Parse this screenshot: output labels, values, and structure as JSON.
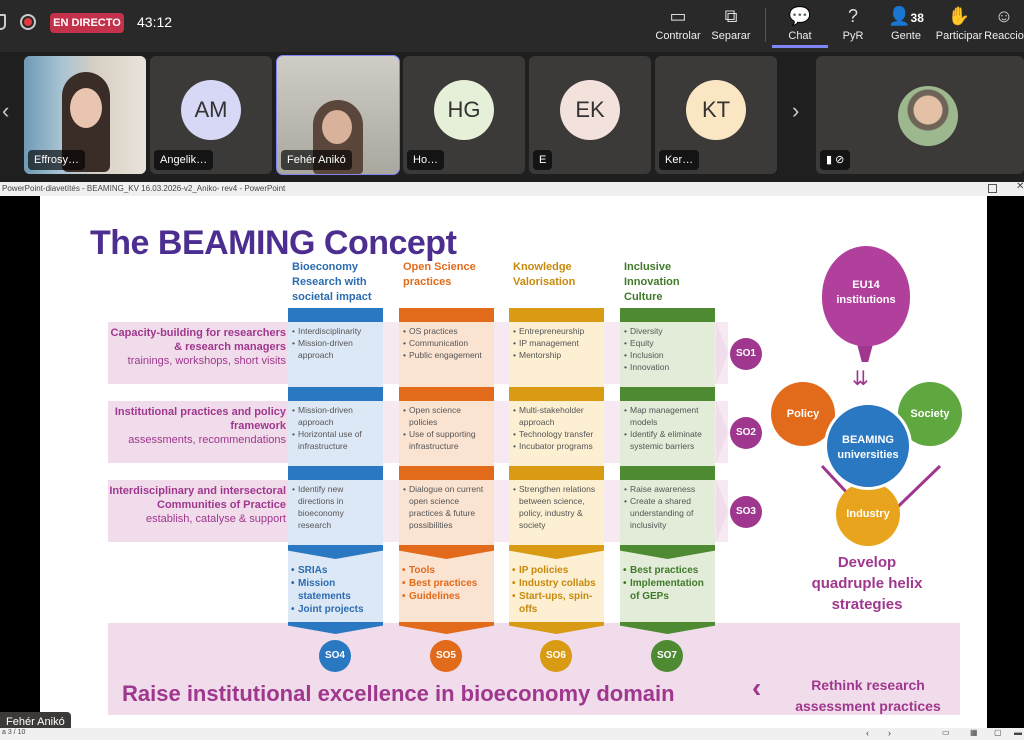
{
  "topbar": {
    "live_label": "EN DIRECTO",
    "timer": "43:12",
    "buttons": [
      {
        "label": "Controlar",
        "icon": "screen-control-icon"
      },
      {
        "label": "Separar",
        "icon": "popout-icon"
      },
      {
        "label": "Chat",
        "icon": "chat-icon"
      },
      {
        "label": "PyR",
        "icon": "qa-icon"
      },
      {
        "label": "Gente",
        "icon": "people-icon",
        "count": "38"
      },
      {
        "label": "Participar",
        "icon": "raise-hand-icon"
      },
      {
        "label": "Reaccio",
        "icon": "reaction-icon"
      }
    ]
  },
  "participants": [
    {
      "name": "Effrosy…",
      "initials": "",
      "type": "video"
    },
    {
      "name": "Angelik…",
      "initials": "AM",
      "color": "#d7d8f5"
    },
    {
      "name": "Fehér Anikó",
      "initials": "",
      "type": "video"
    },
    {
      "name": "Ho…",
      "initials": "HG",
      "color": "#e6efd8"
    },
    {
      "name": "E",
      "initials": "EK",
      "color": "#f3e2dc"
    },
    {
      "name": "Ker…",
      "initials": "KT",
      "color": "#fbe6c4"
    },
    {
      "name": "",
      "initials": "",
      "type": "video"
    }
  ],
  "ppt": {
    "title_bar": "PowerPoint-diavetítés  -  BEAMING_KV 16.03.2026-v2_Aniko- rev4 - PowerPoint",
    "page_indicator": "a 3 / 10",
    "presenter": "Fehér Anikó"
  },
  "slide": {
    "title": "The BEAMING Concept",
    "columns": [
      {
        "header": "Bioeconomy Research with societal impact",
        "color": "#2b78c2",
        "text_color": "#2b6cb0",
        "bg": "#dde8f6",
        "cells": [
          [
            "Interdisciplinarity",
            "Mission-driven approach"
          ],
          [
            "Mission-driven approach",
            "Horizontal use of infrastructure"
          ],
          [
            "Identify new directions in bioeconomy research"
          ]
        ],
        "results": [
          "SRIAs",
          "Mission statements",
          "Joint projects"
        ],
        "so": "SO4"
      },
      {
        "header": "Open Science practices",
        "color": "#e26a1b",
        "text_color": "#e26a1b",
        "bg": "#fbe3d2",
        "cells": [
          [
            "OS practices",
            "Communication",
            "Public engagement"
          ],
          [
            "Open science policies",
            "Use of supporting infrastructure"
          ],
          [
            "Dialogue on current open science practices & future possibilities"
          ]
        ],
        "results": [
          "Tools",
          "Best practices",
          "Guidelines"
        ],
        "so": "SO5"
      },
      {
        "header": "Knowledge Valorisation",
        "color": "#d99a14",
        "text_color": "#c8890c",
        "bg": "#fcefd2",
        "cells": [
          [
            "Entrepreneurship",
            "IP management",
            "Mentorship"
          ],
          [
            "Multi-stakeholder approach",
            "Technology transfer",
            "Incubator programs"
          ],
          [
            "Strengthen relations between science, policy, industry & society"
          ]
        ],
        "results": [
          "IP policies",
          "Industry collabs",
          "Start-ups, spin-offs"
        ],
        "so": "SO6"
      },
      {
        "header": "Inclusive Innovation Culture",
        "color": "#4d8a31",
        "text_color": "#3f7a2a",
        "bg": "#e3ecd8",
        "cells": [
          [
            "Diversity",
            "Equity",
            "Inclusion",
            "Innovation"
          ],
          [
            "Map management models",
            "Identify & eliminate systemic barriers"
          ],
          [
            "Raise awareness",
            "Create a shared understanding of inclusivity"
          ]
        ],
        "results": [
          "Best practices",
          "Implementation of GEPs"
        ],
        "so": "SO7"
      }
    ],
    "rows": [
      {
        "title": "Capacity-building for researchers & research managers",
        "sub": "trainings, workshops, short visits",
        "so": "SO1"
      },
      {
        "title": "Institutional practices and policy framework",
        "sub": "assessments, recommendations",
        "so": "SO2"
      },
      {
        "title": "Interdisciplinary and intersectoral Communities of Practice",
        "sub": "establish, catalyse & support",
        "so": "SO3"
      }
    ],
    "helix": {
      "top": "EU14 institutions",
      "center": "BEAMING universities",
      "left": "Policy",
      "right": "Society",
      "bottom": "Industry",
      "caption": "Develop quadruple helix strategies"
    },
    "bottom_banner": "Raise institutional excellence in bioeconomy domain",
    "bottom_right": "Rethink research assessment practices"
  }
}
